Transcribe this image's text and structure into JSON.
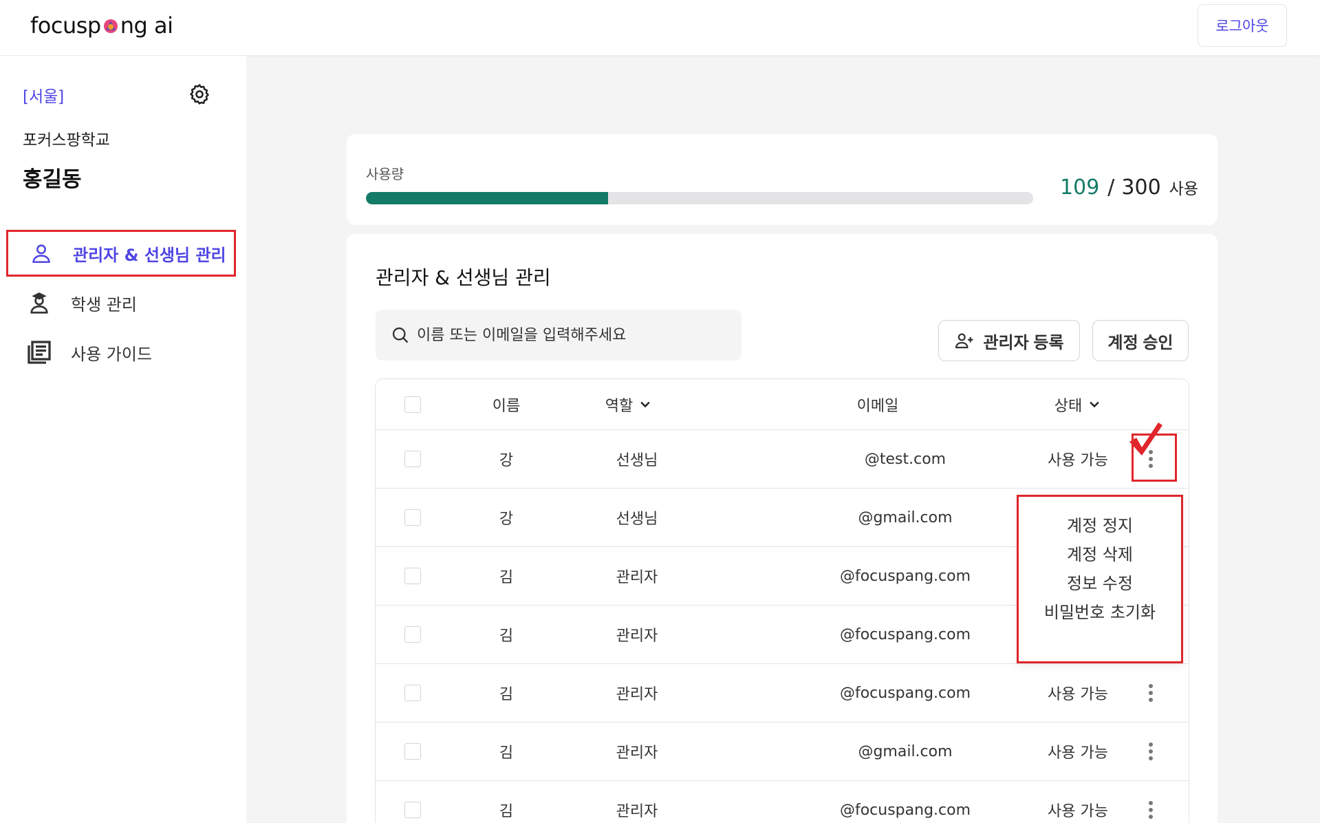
{
  "app": {
    "logo_prefix": "focusp",
    "logo_suffix": "ng ai",
    "logout_label": "로그아웃"
  },
  "sidebar": {
    "region": "[서울]",
    "school": "포커스팡학교",
    "user_name": "홍길동",
    "items": [
      {
        "label": "관리자 & 선생님 관리",
        "icon": "person-icon",
        "active": true
      },
      {
        "label": "학생 관리",
        "icon": "student-icon",
        "active": false
      },
      {
        "label": "사용 가이드",
        "icon": "guide-book-icon",
        "active": false
      }
    ]
  },
  "usage": {
    "label": "사용량",
    "used": "109",
    "separator": "/",
    "total": "300",
    "unit": "사용",
    "fraction": 0.363
  },
  "main": {
    "title": "관리자 & 선생님 관리",
    "search_placeholder": "이름 또는 이메일을 입력해주세요",
    "add_admin_label": "관리자 등록",
    "approve_label": "계정 승인",
    "columns": {
      "name": "이름",
      "role": "역할",
      "email": "이메일",
      "status": "상태"
    },
    "rows": [
      {
        "name": "강",
        "role": "선생님",
        "email": "@test.com",
        "status": "사용 가능"
      },
      {
        "name": "강",
        "role": "선생님",
        "email": "@gmail.com",
        "status": ""
      },
      {
        "name": "김",
        "role": "관리자",
        "email": "@focuspang.com",
        "status": ""
      },
      {
        "name": "김",
        "role": "관리자",
        "email": "@focuspang.com",
        "status": ""
      },
      {
        "name": "김",
        "role": "관리자",
        "email": "@focuspang.com",
        "status": "사용 가능"
      },
      {
        "name": "김",
        "role": "관리자",
        "email": "@gmail.com",
        "status": "사용 가능"
      },
      {
        "name": "김",
        "role": "관리자",
        "email": "@focuspang.com",
        "status": "사용 가능"
      }
    ]
  },
  "context_menu": {
    "items": [
      "계정 정지",
      "계정 삭제",
      "정보 수정",
      "비밀번호 초기화"
    ]
  },
  "colors": {
    "accent": "#4f46e5",
    "usage_fill": "#137a66",
    "highlight": "#e0252b"
  }
}
